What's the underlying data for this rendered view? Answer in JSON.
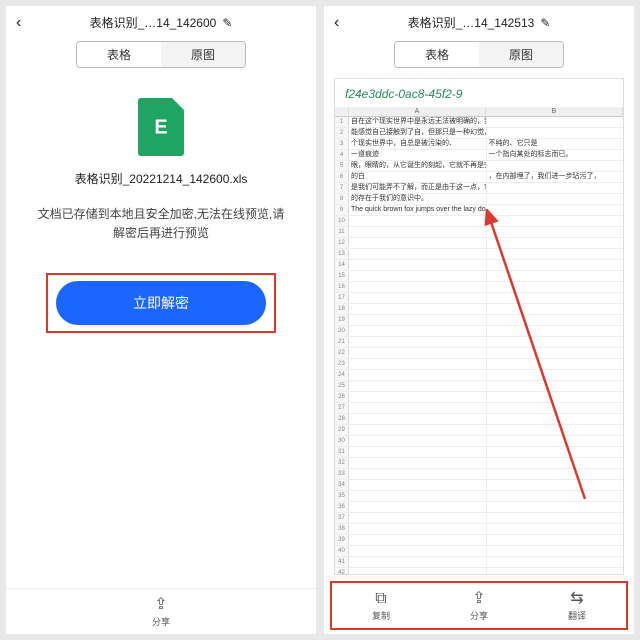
{
  "left": {
    "title": "表格识别_…14_142600",
    "tabs": {
      "a": "表格",
      "b": "原图"
    },
    "filename": "表格识别_20221214_142600.xls",
    "desc": "文档已存储到本地且安全加密,无法在线预览,请解密后再进行预览",
    "decrypt": "立即解密",
    "share": "分享"
  },
  "right": {
    "title": "表格识别_…14_142513",
    "tabs": {
      "a": "表格",
      "b": "原图"
    },
    "sheetTitle": "f24e3ddc-0ac8-45f2-9",
    "colA": "A",
    "colB": "B",
    "rows": [
      {
        "a": "自在这个现实世界中是永远无法被明确的，我们可",
        "b": ""
      },
      {
        "a": "能感觉自己接触到了自，但那只是一种幻觉，在这",
        "b": ""
      },
      {
        "a": "个现实世界中，自总是被污染的、",
        "b": "不纯的、它只是"
      },
      {
        "a": "一道痕迹",
        "b": "一个指向某处的标志而已。"
      },
      {
        "a": "眼，眼睛的，从它诞生的刻起，它就不再是完美",
        "b": ""
      },
      {
        "a": "的白",
        "b": "，在内部埋了，我们进一步玷污了，"
      },
      {
        "a": "是我们可能弄不了解，而正是由于这一点，它清晰",
        "b": ""
      },
      {
        "a": "的存在于我们的意识中。",
        "b": ""
      },
      {
        "a": "The quick brown fox jumps over the lazy dog.",
        "b": ""
      }
    ],
    "bottom": {
      "copy": "复制",
      "share": "分享",
      "translate": "翻译"
    }
  }
}
